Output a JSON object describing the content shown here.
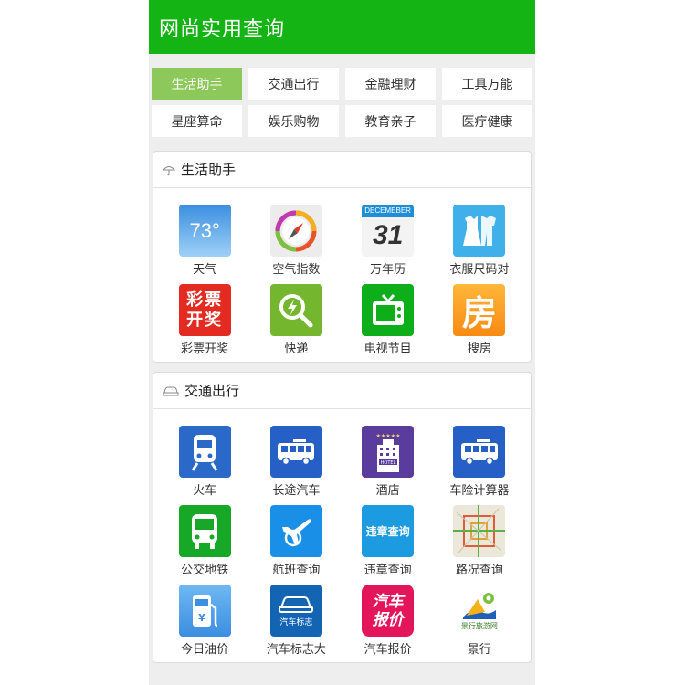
{
  "app": {
    "title": "网尚实用查询"
  },
  "tabs": [
    "生活助手",
    "交通出行",
    "金融理财",
    "工具万能",
    "星座算命",
    "娱乐购物",
    "教育亲子",
    "医疗健康"
  ],
  "life": {
    "title": "生活助手",
    "items": [
      {
        "label": "天气",
        "icon": "weather-icon",
        "text": "73°"
      },
      {
        "label": "空气指数",
        "icon": "compass-icon"
      },
      {
        "label": "万年历",
        "icon": "calendar-icon",
        "month": "DECEMEBER",
        "day": "31"
      },
      {
        "label": "衣服尺码对",
        "icon": "clothing-icon"
      },
      {
        "label": "彩票开奖",
        "icon": "lottery-icon",
        "line1": "彩票",
        "line2": "开奖"
      },
      {
        "label": "快递",
        "icon": "express-search-icon"
      },
      {
        "label": "电视节目",
        "icon": "tv-icon"
      },
      {
        "label": "搜房",
        "icon": "house-icon",
        "glyph": "房"
      }
    ]
  },
  "traffic": {
    "title": "交通出行",
    "items": [
      {
        "label": "火车",
        "icon": "train-icon"
      },
      {
        "label": "长途汽车",
        "icon": "coach-bus-icon"
      },
      {
        "label": "酒店",
        "icon": "hotel-icon",
        "sign": "HOTEL"
      },
      {
        "label": "车险计算器",
        "icon": "car-insurance-bus-icon"
      },
      {
        "label": "公交地铁",
        "icon": "city-bus-icon"
      },
      {
        "label": "航班查询",
        "icon": "flight-icon"
      },
      {
        "label": "违章查询",
        "icon": "violation-search-icon",
        "text": "违章查询"
      },
      {
        "label": "路况查询",
        "icon": "traffic-map-icon"
      },
      {
        "label": "今日油价",
        "icon": "fuel-pump-icon"
      },
      {
        "label": "汽车标志大",
        "icon": "car-logo-icon",
        "text": "汽车标志"
      },
      {
        "label": "汽车报价",
        "icon": "car-price-icon",
        "line1": "汽车",
        "line2": "报价"
      },
      {
        "label": "景行",
        "icon": "travel-icon",
        "text": "景行旅游网"
      }
    ]
  },
  "colors": {
    "topbar": "#14b414",
    "active_tab": "#8cc85a",
    "page_bg": "#eeeeee"
  }
}
